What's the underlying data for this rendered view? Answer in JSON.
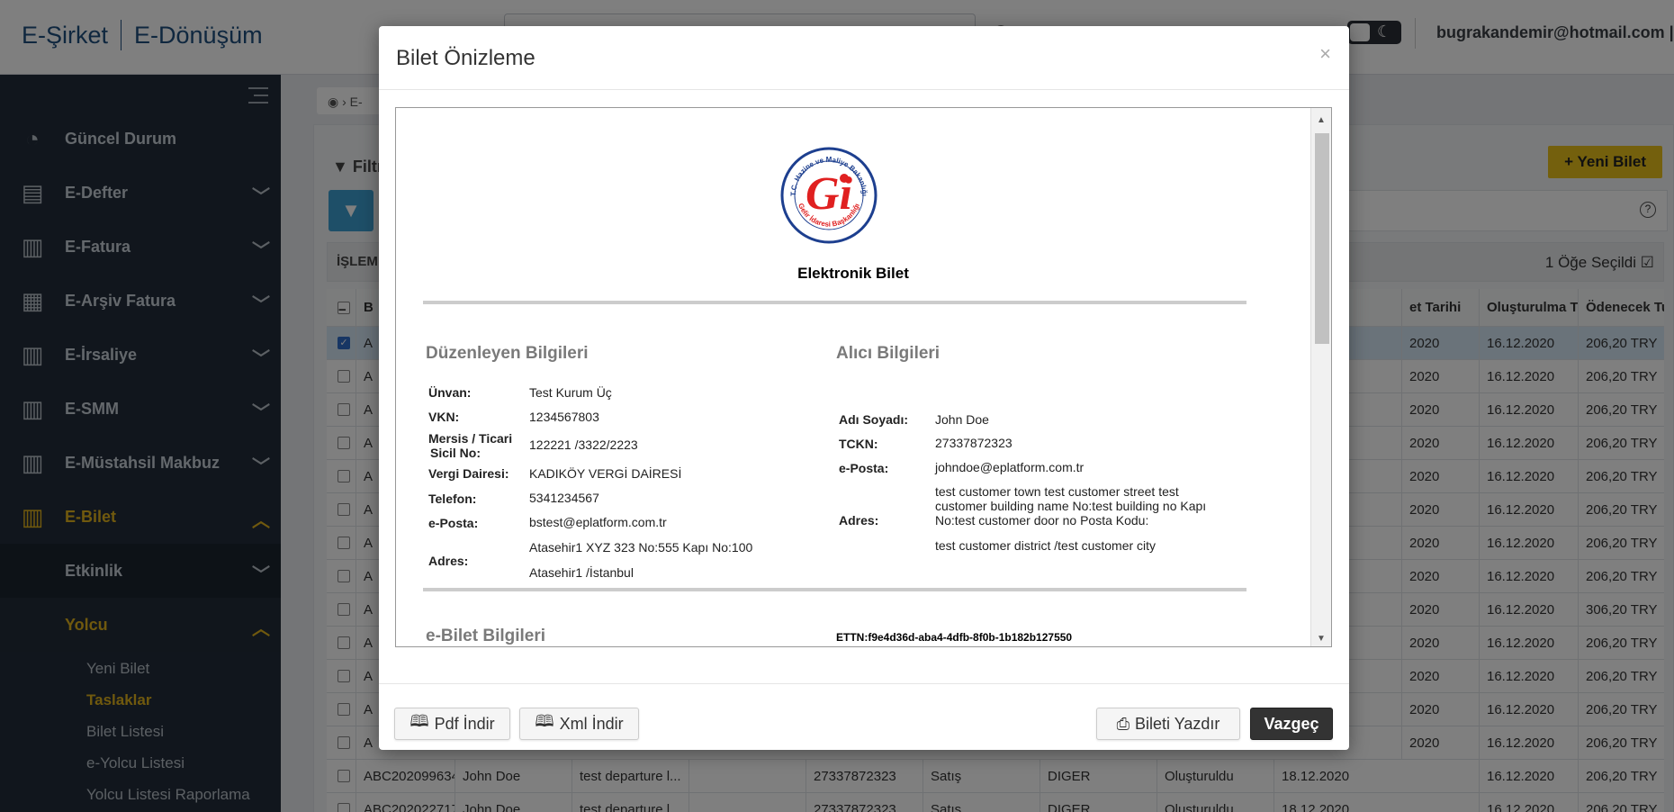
{
  "header": {
    "logo_left": "E-Şirket",
    "logo_right": "E-Dönüşüm",
    "user": "bugrakandemir@hotmail.com | Ç"
  },
  "sidebar": {
    "items": [
      {
        "label": "Güncel Durum",
        "icon": "gauge-icon"
      },
      {
        "label": "E-Defter",
        "icon": "book-icon"
      },
      {
        "label": "E-Fatura",
        "icon": "receipt-icon"
      },
      {
        "label": "E-Arşiv Fatura",
        "icon": "archive-icon"
      },
      {
        "label": "E-İrsaliye",
        "icon": "receipt-icon"
      },
      {
        "label": "E-SMM",
        "icon": "receipt-icon"
      },
      {
        "label": "E-Müstahsil Makbuz",
        "icon": "receipt-icon"
      },
      {
        "label": "E-Bilet",
        "icon": "receipt-icon"
      }
    ],
    "sub": {
      "etkinlik": "Etkinlik",
      "yolcu": "Yolcu"
    },
    "yolcu_items": [
      "Yeni Bilet",
      "Taslaklar",
      "Bilet Listesi",
      "e-Yolcu Listesi",
      "Yolcu Listesi Raporlama"
    ]
  },
  "page": {
    "crumb": "E-",
    "filter_label": "Filtre",
    "new_ticket": "Yeni Bilet",
    "islem": "İŞLEM",
    "selected": "1 Öğe Seçildi",
    "columns": [
      "B",
      "",
      "",
      "",
      "",
      "",
      "",
      "",
      "et Tarihi",
      "Oluşturulma T...",
      "Ödenecek Tutar"
    ],
    "rows": [
      {
        "a": "A",
        "date1": "2020",
        "date2": "16.12.2020",
        "amount": "206,20 TRY"
      },
      {
        "a": "A",
        "date1": "2020",
        "date2": "16.12.2020",
        "amount": "206,20 TRY"
      },
      {
        "a": "A",
        "date1": "2020",
        "date2": "16.12.2020",
        "amount": "206,20 TRY"
      },
      {
        "a": "A",
        "date1": "2020",
        "date2": "16.12.2020",
        "amount": "206,20 TRY"
      },
      {
        "a": "A",
        "date1": "2020",
        "date2": "16.12.2020",
        "amount": "206,20 TRY"
      },
      {
        "a": "A",
        "date1": "2020",
        "date2": "16.12.2020",
        "amount": "206,20 TRY"
      },
      {
        "a": "A",
        "date1": "2020",
        "date2": "16.12.2020",
        "amount": "206,20 TRY"
      },
      {
        "a": "A",
        "date1": "2020",
        "date2": "16.12.2020",
        "amount": "206,20 TRY"
      },
      {
        "a": "A",
        "date1": "2020",
        "date2": "16.12.2020",
        "amount": "306,20 TRY"
      },
      {
        "a": "A",
        "date1": "2020",
        "date2": "16.12.2020",
        "amount": "206,20 TRY"
      },
      {
        "a": "A",
        "date1": "2020",
        "date2": "16.12.2020",
        "amount": "206,20 TRY"
      },
      {
        "a": "A",
        "date1": "2020",
        "date2": "16.12.2020",
        "amount": "206,20 TRY"
      },
      {
        "a": "A",
        "date1": "2020",
        "date2": "16.12.2020",
        "amount": "206,20 TRY"
      }
    ],
    "full_rows": [
      {
        "id": "ABC202099634...",
        "name": "John Doe",
        "dep": "test departure l...",
        "tckn": "27337872323",
        "type": "Satış",
        "cat": "DIGER",
        "status": "Oluşturuldu",
        "d1": "18.12.2020",
        "d2": "16.12.2020",
        "amount": "206,20 TRY"
      },
      {
        "id": "ABC202022717...",
        "name": "John Doe",
        "dep": "test departure l...",
        "tckn": "27337872323",
        "type": "Satış",
        "cat": "DIGER",
        "status": "Oluşturuldu",
        "d1": "18.12.2020",
        "d2": "16.12.2020",
        "amount": "206,20 TRY"
      }
    ]
  },
  "modal": {
    "title": "Bilet Önizleme",
    "close": "×",
    "doc_title": "Elektronik Bilet",
    "logo_text_top": "T.C. Hazine ve Maliye Bakanlığı",
    "logo_text_bottom": "Gelir İdaresi Başkanlığı",
    "issuer_title": "Düzenleyen Bilgileri",
    "buyer_title": "Alıcı Bilgileri",
    "issuer": {
      "unvan_l": "Ünvan:",
      "unvan": "Test Kurum Üç",
      "vkn_l": "VKN:",
      "vkn": "1234567803",
      "mersis_l1": "Mersis / Ticari",
      "mersis_l2": "Sicil No:",
      "mersis": "122221 /3322/2223",
      "vd_l": "Vergi Dairesi:",
      "vd": "KADIKÖY VERGİ DAİRESİ",
      "tel_l": "Telefon:",
      "tel": "5341234567",
      "mail_l": "e-Posta:",
      "mail": "bstest@eplatform.com.tr",
      "adres_l": "Adres:",
      "adres1": "Atasehir1 XYZ 323 No:555 Kapı No:100",
      "adres2": "Atasehir1 /İstanbul"
    },
    "buyer": {
      "name_l": "Adı Soyadı:",
      "name": "John Doe",
      "tckn_l": "TCKN:",
      "tckn": "27337872323",
      "mail_l": "e-Posta:",
      "mail": "johndoe@eplatform.com.tr",
      "adres_l": "Adres:",
      "adres1": "test customer town test customer street test",
      "adres2": "customer building name No:test building no Kapı",
      "adres3": "No:test customer door no Posta Kodu:",
      "adres4": "test customer district /test customer city"
    },
    "ebilet_title": "e-Bilet Bilgileri",
    "ettn": "ETTN:f9e4d36d-aba4-4dfb-8f0b-1b182b127550",
    "buttons": {
      "pdf": "Pdf İndir",
      "xml": "Xml İndir",
      "print": "Bileti Yazdır",
      "cancel": "Vazgeç"
    }
  }
}
